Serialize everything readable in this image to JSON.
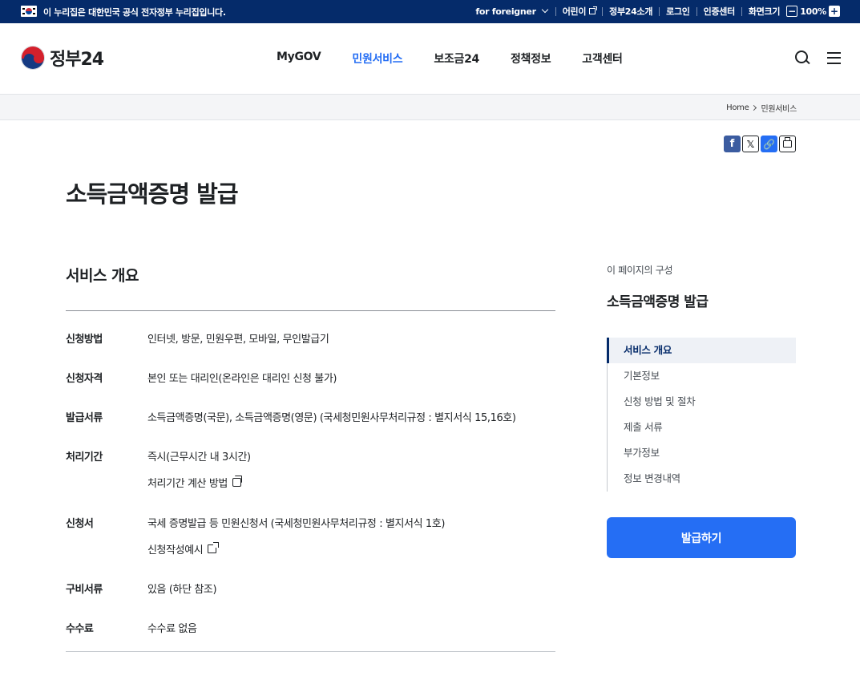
{
  "gov_banner": {
    "official_notice": "이 누리집은 대한민국 공식 전자정부 누리집입니다.",
    "links": {
      "foreigner": "for foreigner",
      "kids": "어린이",
      "about": "정부24소개",
      "login": "로그인",
      "cert": "인증센터",
      "zoom_label": "화면크기",
      "zoom_minus": "−",
      "zoom_value": "100%",
      "zoom_plus": "+"
    }
  },
  "header": {
    "logo_text": "정부24",
    "nav": [
      "MyGOV",
      "민원서비스",
      "보조금24",
      "정책정보",
      "고객센터"
    ],
    "active_nav": "민원서비스"
  },
  "breadcrumb": [
    "Home",
    "민원서비스"
  ],
  "share": {
    "facebook": "f",
    "x": "𝕏",
    "link": "🔗"
  },
  "page_title": "소득금액증명 발급",
  "overview": {
    "section_title": "서비스 개요",
    "rows": [
      {
        "key": "신청방법",
        "value": "인터넷, 방문, 민원우편, 모바일, 무인발급기"
      },
      {
        "key": "신청자격",
        "value": "본인 또는 대리인(온라인은 대리인 신청 불가)"
      },
      {
        "key": "발급서류",
        "value": "소득금액증명(국문), 소득금액증명(영문) (국세청민원사무처리규정 : 별지서식 15,16호)"
      },
      {
        "key": "처리기간",
        "value": "즉시(근무시간 내 3시간)",
        "link": "처리기간 계산 방법"
      },
      {
        "key": "신청서",
        "value": "국세 증명발급 등 민원신청서 (국세청민원사무처리규정 : 별지서식 1호)",
        "link": "신청작성예시"
      },
      {
        "key": "구비서류",
        "value": "있음 (하단 참조)"
      },
      {
        "key": "수수료",
        "value": "수수료 없음"
      }
    ]
  },
  "toc": {
    "caption": "이 페이지의 구성",
    "title": "소득금액증명 발급",
    "items": [
      "서비스 개요",
      "기본정보",
      "신청 방법 및 절차",
      "제출 서류",
      "부가정보",
      "정보 변경내역"
    ],
    "active_item": "서비스 개요"
  },
  "apply_button": "발급하기",
  "colors": {
    "gov_bar": "#052b6a",
    "accent": "#256ef4",
    "text": "#1e2124"
  }
}
